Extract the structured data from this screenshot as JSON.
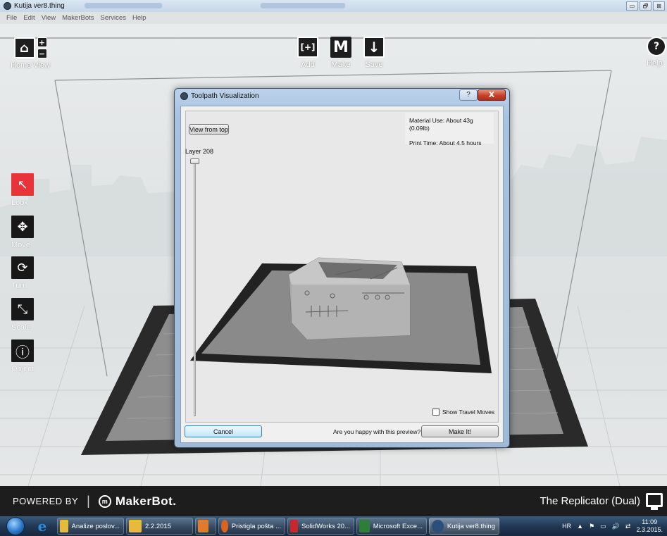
{
  "window": {
    "title": "Kutija ver8.thing",
    "buttons": [
      "▭",
      "🗗",
      "⊠"
    ]
  },
  "menu": [
    "File",
    "Edit",
    "View",
    "MakerBots",
    "Services",
    "Help"
  ],
  "toolbar": {
    "home_view_label": "Home View",
    "zoom_in": "+",
    "zoom_out": "−",
    "add_label": "Add",
    "add_glyph": "[+]",
    "make_label": "Make",
    "make_glyph": "M",
    "save_label": "Save",
    "save_glyph": "↓",
    "help_label": "Help",
    "help_glyph": "?"
  },
  "sidebar": [
    {
      "label": "Look",
      "icon": "look-arrow-icon",
      "glyph": "↖",
      "active": true
    },
    {
      "label": "Move",
      "icon": "move-arrows-icon",
      "glyph": "✥",
      "active": false
    },
    {
      "label": "Turn",
      "icon": "rotate-icon",
      "glyph": "⟳",
      "active": false
    },
    {
      "label": "Scale",
      "icon": "scale-arrow-icon",
      "glyph": "⤡",
      "active": false
    },
    {
      "label": "Object",
      "icon": "info-icon",
      "glyph": "ⓘ",
      "active": false
    }
  ],
  "dialog": {
    "title": "Toolpath Visualization",
    "help_glyph": "?",
    "close_glyph": "X",
    "view_from_top": "View from top",
    "layer_label": "Layer 208",
    "layer_value": 208,
    "material_use": "Material Use: About 43g (0.09lb)",
    "print_time": "Print Time: About 4.5 hours",
    "show_travel_moves": "Show Travel Moves",
    "show_travel_checked": false,
    "cancel": "Cancel",
    "question": "Are you happy with this preview?",
    "make_it": "Make It!"
  },
  "brand": {
    "powered_by": "POWERED BY",
    "separator": "|",
    "logo_glyph": "m",
    "makerbot": "MakerBot.",
    "printer": "The Replicator (Dual)"
  },
  "taskbar": {
    "ie_glyph": "e",
    "tasks": [
      {
        "label": "Analize poslov...",
        "icon_color": "#e8b93a"
      },
      {
        "label": "2.2.2015",
        "icon_color": "#e8b93a"
      },
      {
        "label": "",
        "icon_color": "#e37a2b"
      },
      {
        "label": "Pristigla pošta ...",
        "icon_color": "#d9641e"
      },
      {
        "label": "SolidWorks 20...",
        "icon_color": "#c8282d"
      },
      {
        "label": "Microsoft Exce...",
        "icon_color": "#2e7d39"
      },
      {
        "label": "Kutija ver8.thing",
        "icon_color": "#2b4f7a"
      }
    ],
    "lang": "HR",
    "time": "11:09",
    "date": "2.3.2015."
  },
  "colors": {
    "look_active": "#e8333b",
    "taskbar": "#1f3550",
    "brandbar": "#1d1d1d"
  }
}
